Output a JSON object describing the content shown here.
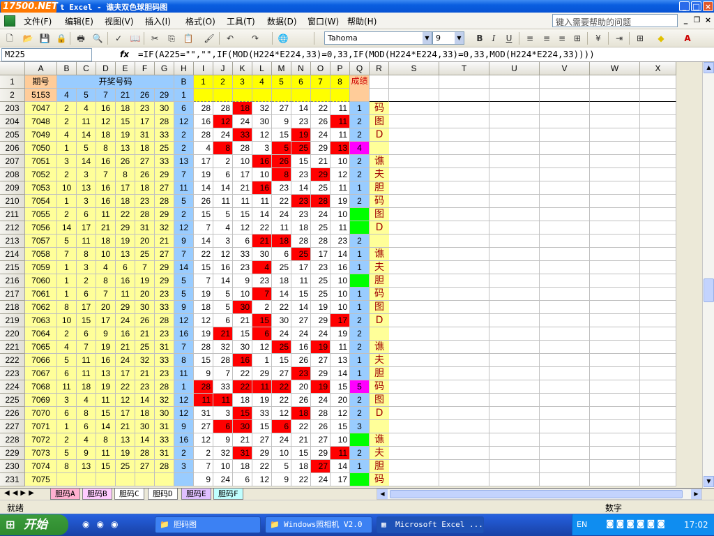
{
  "window": {
    "logo": "17500.NET",
    "title": "t Excel - 谯夫双色球胆码图"
  },
  "menu": {
    "items": [
      "文件(F)",
      "编辑(E)",
      "视图(V)",
      "插入(I)",
      "格式(O)",
      "工具(T)",
      "数据(D)",
      "窗口(W)",
      "帮助(H)"
    ],
    "help_placeholder": "键入需要帮助的问题"
  },
  "toolbar": {
    "font": "Tahoma",
    "size": "9"
  },
  "formula_bar": {
    "cell_ref": "M225",
    "fx": "fx",
    "formula": "=IF(A225=\"\",\"\",IF(MOD(H224*E224,33)=0,33,IF(MOD(H224*E224,33)=0,33,MOD(H224*E224,33))))"
  },
  "columns": [
    "A",
    "B",
    "C",
    "D",
    "E",
    "F",
    "G",
    "H",
    "I",
    "J",
    "K",
    "L",
    "M",
    "N",
    "O",
    "P",
    "Q",
    "R",
    "S",
    "T",
    "U",
    "V",
    "W",
    "X"
  ],
  "header_rows": {
    "r1": {
      "rownum": "1",
      "a": "期号",
      "bg_label": "开奖号码",
      "h": "B",
      "i_p": [
        "1",
        "2",
        "3",
        "4",
        "5",
        "6",
        "7",
        "8"
      ],
      "q": "成绩"
    },
    "r2": {
      "rownum": "2",
      "a": "5153",
      "bg": [
        "4",
        "5",
        "7",
        "21",
        "26",
        "29"
      ],
      "h": "1"
    }
  },
  "rows": [
    {
      "n": "203",
      "a": "7047",
      "bg": [
        "2",
        "4",
        "16",
        "18",
        "23",
        "30"
      ],
      "h": "6",
      "ip": [
        "28",
        "28",
        "18",
        "32",
        "27",
        "14",
        "22",
        "11"
      ],
      "red": [
        2
      ],
      "q": "1",
      "qc": "b",
      "r": "码"
    },
    {
      "n": "204",
      "a": "7048",
      "bg": [
        "2",
        "11",
        "12",
        "15",
        "17",
        "28"
      ],
      "h": "12",
      "ip": [
        "16",
        "12",
        "24",
        "30",
        "9",
        "23",
        "26",
        "11"
      ],
      "red": [
        1,
        7
      ],
      "q": "2",
      "qc": "b",
      "r": "图"
    },
    {
      "n": "205",
      "a": "7049",
      "bg": [
        "4",
        "14",
        "18",
        "19",
        "31",
        "33"
      ],
      "h": "2",
      "ip": [
        "28",
        "24",
        "33",
        "12",
        "15",
        "19",
        "24",
        "11"
      ],
      "red": [
        2,
        5
      ],
      "q": "2",
      "qc": "b",
      "r": "D"
    },
    {
      "n": "206",
      "a": "7050",
      "bg": [
        "1",
        "5",
        "8",
        "13",
        "18",
        "25"
      ],
      "h": "2",
      "ip": [
        "4",
        "8",
        "28",
        "3",
        "5",
        "25",
        "29",
        "13"
      ],
      "red": [
        1,
        4,
        5,
        7
      ],
      "q": "4",
      "qc": "m",
      "r": ""
    },
    {
      "n": "207",
      "a": "7051",
      "bg": [
        "3",
        "14",
        "16",
        "26",
        "27",
        "33"
      ],
      "h": "13",
      "ip": [
        "17",
        "2",
        "10",
        "16",
        "26",
        "15",
        "21",
        "10"
      ],
      "red": [
        3,
        4
      ],
      "q": "2",
      "qc": "b",
      "r": "谯"
    },
    {
      "n": "208",
      "a": "7052",
      "bg": [
        "2",
        "3",
        "7",
        "8",
        "26",
        "29"
      ],
      "h": "7",
      "ip": [
        "19",
        "6",
        "17",
        "10",
        "8",
        "23",
        "29",
        "12"
      ],
      "red": [
        4,
        6
      ],
      "q": "2",
      "qc": "b",
      "r": "夫"
    },
    {
      "n": "209",
      "a": "7053",
      "bg": [
        "10",
        "13",
        "16",
        "17",
        "18",
        "27"
      ],
      "h": "11",
      "ip": [
        "14",
        "14",
        "21",
        "16",
        "23",
        "14",
        "25",
        "11"
      ],
      "red": [
        3
      ],
      "q": "1",
      "qc": "b",
      "r": "胆"
    },
    {
      "n": "210",
      "a": "7054",
      "bg": [
        "1",
        "3",
        "16",
        "18",
        "23",
        "28"
      ],
      "h": "5",
      "ip": [
        "26",
        "11",
        "11",
        "11",
        "22",
        "23",
        "28",
        "19"
      ],
      "red": [
        5,
        6
      ],
      "q": "2",
      "qc": "b",
      "r": "码"
    },
    {
      "n": "211",
      "a": "7055",
      "bg": [
        "2",
        "6",
        "11",
        "22",
        "28",
        "29"
      ],
      "h": "2",
      "ip": [
        "15",
        "5",
        "15",
        "14",
        "24",
        "23",
        "24",
        "10"
      ],
      "red": [],
      "q": "",
      "qc": "g",
      "r": "图"
    },
    {
      "n": "212",
      "a": "7056",
      "bg": [
        "14",
        "17",
        "21",
        "29",
        "31",
        "32"
      ],
      "h": "12",
      "ip": [
        "7",
        "4",
        "12",
        "22",
        "11",
        "18",
        "25",
        "11"
      ],
      "red": [],
      "q": "",
      "qc": "g",
      "r": "D"
    },
    {
      "n": "213",
      "a": "7057",
      "bg": [
        "5",
        "11",
        "18",
        "19",
        "20",
        "21"
      ],
      "h": "9",
      "ip": [
        "14",
        "3",
        "6",
        "21",
        "18",
        "28",
        "28",
        "23"
      ],
      "red": [
        3,
        4
      ],
      "q": "2",
      "qc": "b",
      "r": ""
    },
    {
      "n": "214",
      "a": "7058",
      "bg": [
        "7",
        "8",
        "10",
        "13",
        "25",
        "27"
      ],
      "h": "7",
      "ip": [
        "22",
        "12",
        "33",
        "30",
        "6",
        "25",
        "17",
        "14"
      ],
      "red": [
        5
      ],
      "q": "1",
      "qc": "b",
      "r": "谯"
    },
    {
      "n": "215",
      "a": "7059",
      "bg": [
        "1",
        "3",
        "4",
        "6",
        "7",
        "29"
      ],
      "h": "14",
      "ip": [
        "15",
        "16",
        "23",
        "4",
        "25",
        "17",
        "23",
        "16"
      ],
      "red": [
        3
      ],
      "q": "1",
      "qc": "b",
      "r": "夫"
    },
    {
      "n": "216",
      "a": "7060",
      "bg": [
        "1",
        "2",
        "8",
        "16",
        "19",
        "29"
      ],
      "h": "5",
      "ip": [
        "7",
        "14",
        "9",
        "23",
        "18",
        "11",
        "25",
        "10"
      ],
      "red": [],
      "q": "",
      "qc": "g",
      "r": "胆"
    },
    {
      "n": "217",
      "a": "7061",
      "bg": [
        "1",
        "6",
        "7",
        "11",
        "20",
        "23"
      ],
      "h": "5",
      "ip": [
        "19",
        "5",
        "10",
        "7",
        "14",
        "15",
        "25",
        "10"
      ],
      "red": [
        3
      ],
      "q": "1",
      "qc": "b",
      "r": "码"
    },
    {
      "n": "218",
      "a": "7062",
      "bg": [
        "8",
        "17",
        "20",
        "29",
        "30",
        "33"
      ],
      "h": "9",
      "ip": [
        "18",
        "5",
        "30",
        "2",
        "22",
        "14",
        "19",
        "10"
      ],
      "red": [
        2
      ],
      "q": "1",
      "qc": "b",
      "r": "图"
    },
    {
      "n": "219",
      "a": "7063",
      "bg": [
        "10",
        "15",
        "17",
        "24",
        "26",
        "28"
      ],
      "h": "12",
      "ip": [
        "12",
        "6",
        "21",
        "15",
        "30",
        "27",
        "29",
        "17"
      ],
      "red": [
        3,
        7
      ],
      "q": "2",
      "qc": "b",
      "r": "D"
    },
    {
      "n": "220",
      "a": "7064",
      "bg": [
        "2",
        "6",
        "9",
        "16",
        "21",
        "23"
      ],
      "h": "16",
      "ip": [
        "19",
        "21",
        "15",
        "6",
        "24",
        "24",
        "24",
        "19"
      ],
      "red": [
        1,
        3
      ],
      "q": "2",
      "qc": "b",
      "r": ""
    },
    {
      "n": "221",
      "a": "7065",
      "bg": [
        "4",
        "7",
        "19",
        "21",
        "25",
        "31"
      ],
      "h": "7",
      "ip": [
        "28",
        "32",
        "30",
        "12",
        "25",
        "16",
        "19",
        "11"
      ],
      "red": [
        4,
        6
      ],
      "q": "2",
      "qc": "b",
      "r": "谯"
    },
    {
      "n": "222",
      "a": "7066",
      "bg": [
        "5",
        "11",
        "16",
        "24",
        "32",
        "33"
      ],
      "h": "8",
      "ip": [
        "15",
        "28",
        "16",
        "1",
        "15",
        "26",
        "27",
        "13"
      ],
      "red": [
        2
      ],
      "q": "1",
      "qc": "b",
      "r": "夫"
    },
    {
      "n": "223",
      "a": "7067",
      "bg": [
        "6",
        "11",
        "13",
        "17",
        "21",
        "23"
      ],
      "h": "11",
      "ip": [
        "9",
        "7",
        "22",
        "29",
        "27",
        "23",
        "29",
        "14"
      ],
      "red": [
        5
      ],
      "q": "1",
      "qc": "b",
      "r": "胆"
    },
    {
      "n": "224",
      "a": "7068",
      "bg": [
        "11",
        "18",
        "19",
        "22",
        "23",
        "28"
      ],
      "h": "1",
      "ip": [
        "28",
        "33",
        "22",
        "11",
        "22",
        "20",
        "19",
        "15"
      ],
      "red": [
        0,
        2,
        3,
        4,
        6
      ],
      "q": "5",
      "qc": "m",
      "r": "码"
    },
    {
      "n": "225",
      "a": "7069",
      "bg": [
        "3",
        "4",
        "11",
        "12",
        "14",
        "32"
      ],
      "h": "12",
      "ip": [
        "11",
        "11",
        "18",
        "19",
        "22",
        "26",
        "24",
        "20"
      ],
      "red": [
        0,
        1
      ],
      "q": "2",
      "qc": "b",
      "r": "图"
    },
    {
      "n": "226",
      "a": "7070",
      "bg": [
        "6",
        "8",
        "15",
        "17",
        "18",
        "30"
      ],
      "h": "12",
      "ip": [
        "31",
        "3",
        "15",
        "33",
        "12",
        "18",
        "28",
        "12"
      ],
      "red": [
        2,
        5
      ],
      "q": "2",
      "qc": "b",
      "r": "D"
    },
    {
      "n": "227",
      "a": "7071",
      "bg": [
        "1",
        "6",
        "14",
        "21",
        "30",
        "31"
      ],
      "h": "9",
      "ip": [
        "27",
        "6",
        "30",
        "15",
        "6",
        "22",
        "26",
        "15"
      ],
      "red": [
        1,
        2,
        4
      ],
      "q": "3",
      "qc": "b",
      "r": ""
    },
    {
      "n": "228",
      "a": "7072",
      "bg": [
        "2",
        "4",
        "8",
        "13",
        "14",
        "33"
      ],
      "h": "16",
      "ip": [
        "12",
        "9",
        "21",
        "27",
        "24",
        "21",
        "27",
        "10"
      ],
      "red": [],
      "q": "",
      "qc": "g",
      "r": "谯"
    },
    {
      "n": "229",
      "a": "7073",
      "bg": [
        "5",
        "9",
        "11",
        "19",
        "28",
        "31"
      ],
      "h": "2",
      "ip": [
        "2",
        "32",
        "31",
        "29",
        "10",
        "15",
        "29",
        "11"
      ],
      "red": [
        2,
        7
      ],
      "q": "2",
      "qc": "b",
      "r": "夫"
    },
    {
      "n": "230",
      "a": "7074",
      "bg": [
        "8",
        "13",
        "15",
        "25",
        "27",
        "28"
      ],
      "h": "3",
      "ip": [
        "7",
        "10",
        "18",
        "22",
        "5",
        "18",
        "27",
        "14"
      ],
      "red": [
        6
      ],
      "q": "1",
      "qc": "b",
      "r": "胆"
    },
    {
      "n": "231",
      "a": "7075",
      "bg": [
        "",
        "",
        "",
        "",
        "",
        ""
      ],
      "h": "",
      "ip": [
        "9",
        "24",
        "6",
        "12",
        "9",
        "22",
        "24",
        "17"
      ],
      "red": [],
      "q": "",
      "qc": "g",
      "r": "码"
    }
  ],
  "sheet_tabs": [
    "胆码A",
    "胆码B",
    "胆码C",
    "胆码D",
    "胆码E",
    "胆码F"
  ],
  "active_tab": "胆码D",
  "status": {
    "left": "就绪",
    "right": "数字"
  },
  "taskbar": {
    "start": "开始",
    "tasks": [
      "胆码图",
      "Windows照相机 V2.0",
      "Microsoft Excel ..."
    ],
    "lang": "EN",
    "time": "17:02"
  },
  "colors": {
    "yellow": "#ffff99",
    "blue": "#99ccff",
    "red": "#ff0000",
    "green": "#00ff00",
    "magenta": "#ff00ff",
    "header_orange": "#ffcc99"
  }
}
